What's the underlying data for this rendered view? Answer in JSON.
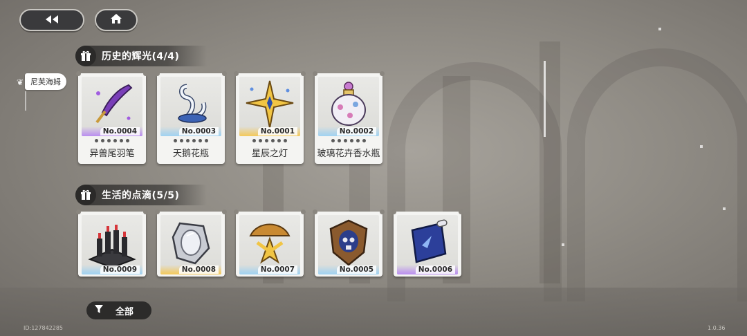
{
  "nav": {
    "back_icon": "rewind-icon",
    "home_icon": "home-icon"
  },
  "side_tab": {
    "label": "尼芙海姆"
  },
  "sections": [
    {
      "title": "历史的辉光(4/4)",
      "icon": "gift-icon",
      "items": [
        {
          "no": "No.0004",
          "name": "异兽尾羽笔",
          "icon": "quill-icon",
          "rarity": "purple"
        },
        {
          "no": "No.0003",
          "name": "天鹅花瓶",
          "icon": "swan-vase-icon",
          "rarity": "blue"
        },
        {
          "no": "No.0001",
          "name": "星辰之灯",
          "icon": "star-lamp-icon",
          "rarity": "gold"
        },
        {
          "no": "No.0002",
          "name": "玻璃花卉香水瓶",
          "icon": "perfume-bottle-icon",
          "rarity": "blue"
        }
      ]
    },
    {
      "title": "生活的点滴(5/5)",
      "icon": "gift-icon",
      "items": [
        {
          "no": "No.0009",
          "name": "",
          "icon": "candle-castle-icon",
          "rarity": "blue"
        },
        {
          "no": "No.0008",
          "name": "",
          "icon": "silver-mirror-icon",
          "rarity": "gold"
        },
        {
          "no": "No.0007",
          "name": "",
          "icon": "golden-shell-icon",
          "rarity": "blue"
        },
        {
          "no": "No.0005",
          "name": "",
          "icon": "skull-shield-icon",
          "rarity": "blue"
        },
        {
          "no": "No.0006",
          "name": "",
          "icon": "blue-scroll-icon",
          "rarity": "purple"
        }
      ]
    }
  ],
  "filter": {
    "label": "全部",
    "icon": "filter-funnel-icon"
  },
  "footer": {
    "uid": "ID:127842285",
    "version": "1.0.36"
  },
  "colors": {
    "purple": "#b98df0",
    "blue": "#9fd2f2",
    "gold": "#f4c95a"
  }
}
